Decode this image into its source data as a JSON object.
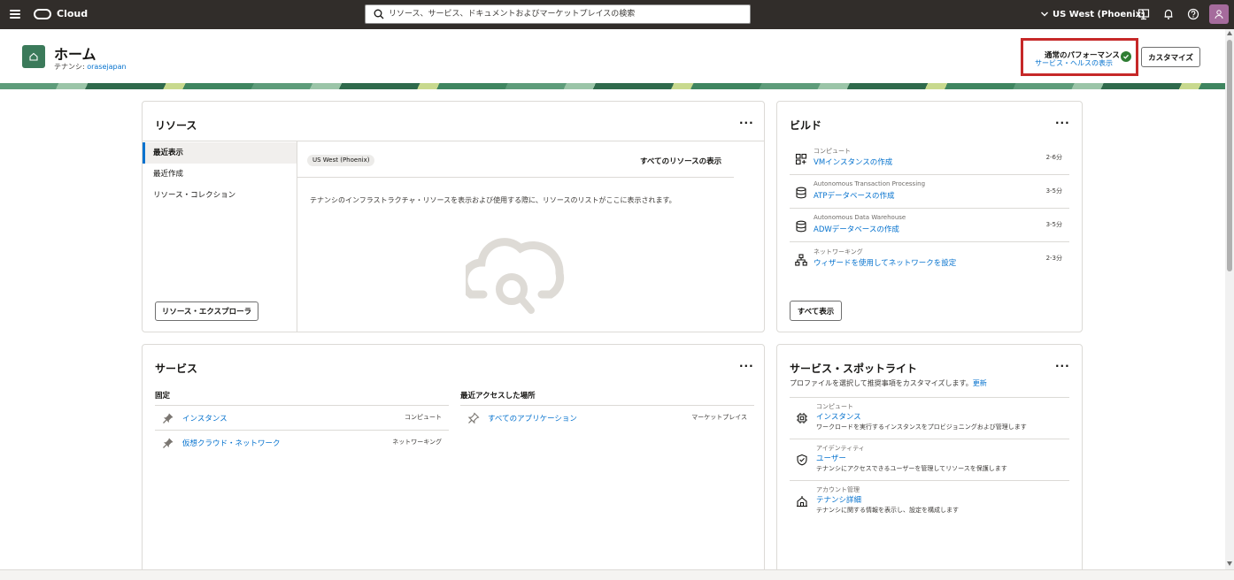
{
  "topbar": {
    "brand": "Cloud",
    "search_placeholder": "リソース、サービス、ドキュメントおよびマーケットプレイスの検索",
    "region": "US West (Phoenix)",
    "icons": [
      "menu-icon",
      "oracle-logo",
      "search-icon",
      "chevron-down-icon",
      "developer-tools-icon",
      "bell-icon",
      "help-icon",
      "user-icon"
    ]
  },
  "header": {
    "title": "ホーム",
    "tenancy_label": "テナンシ: ",
    "tenancy_name": "orasejapan",
    "health_title": "通常のパフォーマンス",
    "health_link": "サービス・ヘルスの表示",
    "customize_label": "カスタマイズ"
  },
  "resources": {
    "title": "リソース",
    "menu": "···",
    "nav": [
      "最近表示",
      "最近作成",
      "リソース・コレクション"
    ],
    "region_chip": "US West (Phoenix)",
    "view_all": "すべてのリソースの表示",
    "empty_text": "テナンシのインフラストラクチャ・リソースを表示および使用する際に、リソースのリストがここに表示されます。",
    "explorer_button": "リソース・エクスプローラ"
  },
  "build": {
    "title": "ビルド",
    "menu": "···",
    "items": [
      {
        "category": "コンピュート",
        "link": "VMインスタンスの作成",
        "duration": "2-6分"
      },
      {
        "category": "Autonomous Transaction Processing",
        "link": "ATPデータベースの作成",
        "duration": "3-5分"
      },
      {
        "category": "Autonomous Data Warehouse",
        "link": "ADWデータベースの作成",
        "duration": "3-5分"
      },
      {
        "category": "ネットワーキング",
        "link": "ウィザードを使用してネットワークを設定",
        "duration": "2-3分"
      }
    ],
    "show_all": "すべて表示"
  },
  "services": {
    "title": "サービス",
    "menu": "···",
    "pinned_heading": "固定",
    "pinned": [
      {
        "name": "インスタンス",
        "category": "コンピュート"
      },
      {
        "name": "仮想クラウド・ネットワーク",
        "category": "ネットワーキング"
      }
    ],
    "recent_heading": "最近アクセスした場所",
    "recent": [
      {
        "name": "すべてのアプリケーション",
        "category": "マーケットプレイス"
      }
    ]
  },
  "spotlight": {
    "title": "サービス・スポットライト",
    "menu": "···",
    "description": "プロファイルを選択して推奨事項をカスタマイズします。",
    "update_link": "更新",
    "items": [
      {
        "category": "コンピュート",
        "link": "インスタンス",
        "desc": "ワークロードを実行するインスタンスをプロビジョニングおよび管理します"
      },
      {
        "category": "アイデンティティ",
        "link": "ユーザー",
        "desc": "テナンシにアクセスできるユーザーを管理してリソースを保護します"
      },
      {
        "category": "アカウント管理",
        "link": "テナンシ詳細",
        "desc": "テナンシに関する情報を表示し、設定を構成します"
      }
    ]
  },
  "colors": {
    "topbar": "#312d2a",
    "link": "#0572ce",
    "home_badge": "#3b7a5a",
    "health_highlight": "#c62828",
    "status_ok": "#2e7d32",
    "avatar": "#a56b9c"
  }
}
